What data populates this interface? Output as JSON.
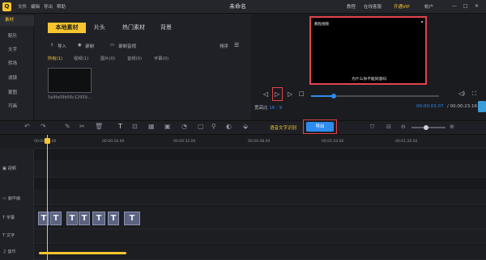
{
  "titlebar": {
    "logo": "Q",
    "menus": [
      "文件",
      "编辑",
      "导出",
      "帮助"
    ],
    "title": "未命名",
    "right": [
      "教程",
      "在线客服"
    ],
    "vip": "开通VIP",
    "account": "帐户"
  },
  "sidebar": {
    "items": [
      "素材",
      "配乐",
      "文字",
      "转场",
      "滤镜",
      "蒙图",
      "可画"
    ]
  },
  "media": {
    "tabs": [
      "本地素材",
      "片头",
      "热门素材",
      "背景"
    ],
    "tools": [
      "导入",
      "录制",
      "录制音视"
    ],
    "sort_label": "排序",
    "filters": [
      "所有(1)",
      "视频(1)",
      "图片(0)",
      "音频(0)",
      "字幕(0)"
    ],
    "thumb_caption": "5a9fa09b56c12959..."
  },
  "preview": {
    "watermark": "教程视频",
    "subtitle": "为什么你不能同意吗",
    "ratio_label": "宽高比",
    "ratio_value": "16 : 9",
    "time_current": "00:00:03.07",
    "time_total": "/ 00:00:23.16",
    "progress": 0.18
  },
  "toolbar": {
    "tts_label": "语音文字识别",
    "export_label": "导出"
  },
  "timeline": {
    "ticks": [
      "00:00:00.00",
      "00:00:16.00",
      "00:00:32.00",
      "00:00:48.00",
      "00:01:04.00",
      "00:01:20.00"
    ],
    "tracks": [
      "视频",
      "画中画",
      "字幕",
      "文字",
      "音乐"
    ],
    "clip_glyph": "T"
  },
  "colors": {
    "accent": "#f7c62f",
    "blue": "#2e8cf0",
    "highlight": "#e0454c"
  }
}
